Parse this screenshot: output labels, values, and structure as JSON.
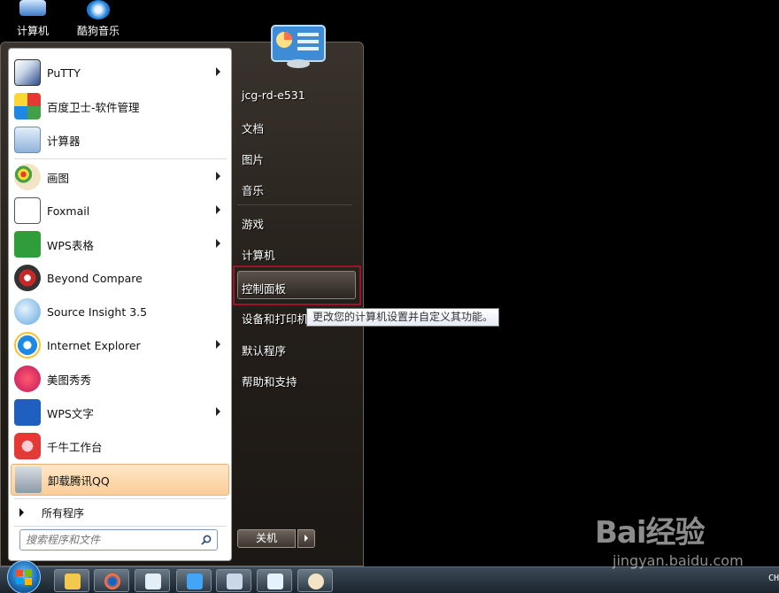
{
  "desktop": {
    "icons": [
      {
        "label": "计算机"
      },
      {
        "label": "酷狗音乐"
      }
    ]
  },
  "start_menu": {
    "pinned": [
      {
        "label": "PuTTY",
        "has_arrow": true
      },
      {
        "label": "百度卫士-软件管理",
        "has_arrow": false
      },
      {
        "label": "计算器",
        "has_arrow": false
      },
      {
        "label": "画图",
        "has_arrow": true
      },
      {
        "label": "Foxmail",
        "has_arrow": true
      },
      {
        "label": "WPS表格",
        "has_arrow": true
      },
      {
        "label": "Beyond Compare",
        "has_arrow": false
      },
      {
        "label": "Source Insight 3.5",
        "has_arrow": false
      },
      {
        "label": "Internet Explorer",
        "has_arrow": true
      },
      {
        "label": "美图秀秀",
        "has_arrow": false
      },
      {
        "label": "WPS文字",
        "has_arrow": true
      },
      {
        "label": "千牛工作台",
        "has_arrow": false
      },
      {
        "label": "卸载腾讯QQ",
        "has_arrow": false
      }
    ],
    "all_programs": "所有程序",
    "search_placeholder": "搜索程序和文件",
    "right": {
      "user": "jcg-rd-e531",
      "documents": "文档",
      "pictures": "图片",
      "music": "音乐",
      "games": "游戏",
      "computer": "计算机",
      "control_panel": "控制面板",
      "devices": "设备和打印机",
      "default_programs": "默认程序",
      "help": "帮助和支持"
    },
    "tooltip": "更改您的计算机设置并自定义其功能。",
    "shutdown": "关机"
  },
  "taskbar": {
    "tray_text": "CH"
  },
  "watermark": {
    "main": "Bai经验",
    "sub": "jingyan.baidu.com"
  },
  "colors": {
    "highlight": "#fbcd97",
    "cp_border": "#a1122a"
  }
}
